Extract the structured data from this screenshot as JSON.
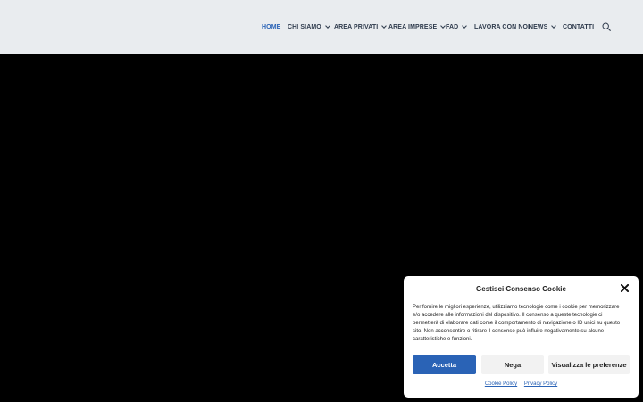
{
  "nav": {
    "items": [
      {
        "label": "HOME",
        "active": true,
        "has_dropdown": false
      },
      {
        "label": "CHI SIAMO",
        "has_dropdown": true
      },
      {
        "label": "AREA PRIVATI",
        "has_dropdown": true
      },
      {
        "label": "AREA IMPRESE",
        "has_dropdown": true
      },
      {
        "label": "FAD",
        "has_dropdown": true
      },
      {
        "label": "LAVORA CON NOI",
        "has_dropdown": false
      },
      {
        "label": "NEWS",
        "has_dropdown": true
      },
      {
        "label": "CONTATTI",
        "has_dropdown": false
      }
    ],
    "search_icon": "search-icon"
  },
  "cookie": {
    "title": "Gestisci Consenso Cookie",
    "text": "Per fornire le migliori esperienze, utilizziamo tecnologie come i cookie per memorizzare e/o accedere alle informazioni del dispositivo. Il consenso a queste tecnologie ci permetterà di elaborare dati come il comportamento di navigazione o ID unici su questo sito. Non acconsentire o ritirare il consenso può influire negativamente su alcune caratteristiche e funzioni.",
    "accept_label": "Accetta",
    "deny_label": "Nega",
    "prefs_label": "Visualizza le preferenze",
    "cookie_policy_label": "Cookie Policy",
    "privacy_policy_label": "Privacy Policy"
  },
  "colors": {
    "accent": "#2a63b6",
    "header_bg": "#e9ecef",
    "hero_bg": "#000000"
  }
}
